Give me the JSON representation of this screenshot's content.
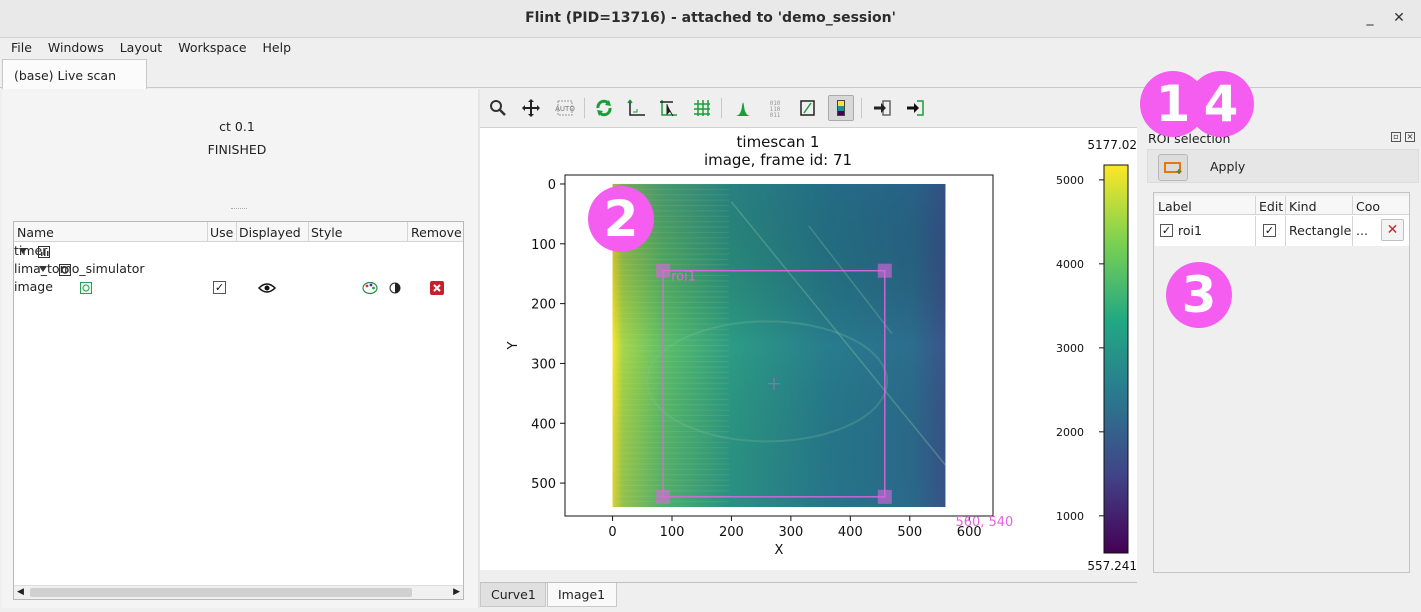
{
  "window": {
    "title": "Flint (PID=13716) - attached to 'demo_session'",
    "minimize": "_",
    "close": "✕"
  },
  "menu": [
    "File",
    "Windows",
    "Layout",
    "Workspace",
    "Help"
  ],
  "main_tab": "(base) Live scan",
  "status": {
    "line1": "ct 0.1",
    "line2": "FINISHED"
  },
  "tree": {
    "columns": [
      "Name",
      "Use",
      "Displayed",
      "Style",
      "Remove"
    ],
    "rows": [
      {
        "name": "timer",
        "icon": "chart-icon",
        "level": 0
      },
      {
        "name": "lima_tomo_simulator",
        "icon": "device-icon",
        "level": 1
      },
      {
        "name": "image",
        "icon": "image-icon",
        "level": 2,
        "use": true,
        "displayed": true
      }
    ]
  },
  "plot": {
    "title_line1": "timescan 1",
    "title_line2": "image, frame id: 71",
    "xlabel": "X",
    "ylabel": "Y",
    "x_ticks": [
      "0",
      "100",
      "200",
      "300",
      "400",
      "500",
      "600"
    ],
    "y_ticks": [
      "0",
      "100",
      "200",
      "300",
      "400",
      "500"
    ],
    "x_range": [
      -80,
      640
    ],
    "y_range": [
      -15,
      555
    ],
    "image_extent_x": [
      0,
      560
    ],
    "image_extent_y": [
      0,
      540
    ],
    "colorbar": {
      "max_label": "5177.023",
      "min_label": "557.2411",
      "ticks": [
        "5000",
        "4000",
        "3000",
        "2000",
        "1000"
      ],
      "tick_values": [
        5000,
        4000,
        3000,
        2000,
        1000
      ],
      "range": [
        557.2411,
        5177.023
      ],
      "colormap": "viridis"
    },
    "roi": {
      "label": "roi1",
      "x1": 85,
      "y1": 145,
      "x2": 458,
      "y2": 523
    },
    "cursor_readout": "560, 540"
  },
  "bottom_tabs": [
    "Curve1",
    "Image1"
  ],
  "roi_panel": {
    "title": "ROI selection",
    "apply_label": "Apply",
    "columns": [
      "Label",
      "Edit",
      "Kind",
      "Coo"
    ],
    "row": {
      "label": "roi1",
      "visible": true,
      "edit": true,
      "kind": "Rectangle",
      "coords": "..."
    }
  },
  "badges": [
    "1",
    "2",
    "3",
    "4"
  ],
  "colors": {
    "badge": "#f55df0",
    "roi": "#e066e0",
    "accent_green": "#1a9e3a"
  }
}
